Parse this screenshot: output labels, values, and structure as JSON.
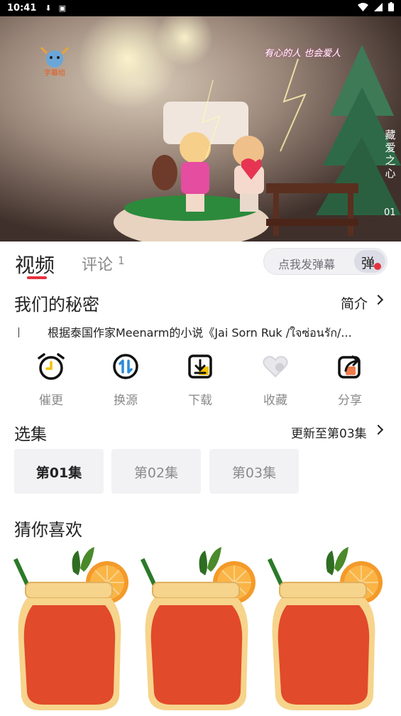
{
  "status_bar": {
    "time": "10:41",
    "icons": [
      "download-icon",
      "notification-icon",
      "wifi-icon",
      "signal-icon",
      "battery-icon"
    ]
  },
  "video": {
    "overlay_subtitle": "有心的人 也会爱人",
    "vertical_title": "藏爱之心",
    "episode_number": "01",
    "logo_caption": "字幕组"
  },
  "tabs": {
    "video_label": "视频",
    "comment_label": "评论",
    "comment_count": "1"
  },
  "danmaku": {
    "placeholder": "点我发弹幕",
    "toggle_label": "弹"
  },
  "drama": {
    "title": "我们的秘密",
    "intro_label": "简介",
    "synopsis": "根据泰国作家Meenarm的小说《Jai Sorn Ruk /ใจซ่อนรัก/..."
  },
  "actions": [
    {
      "label": "催更",
      "icon": "alarm-clock-icon"
    },
    {
      "label": "换源",
      "icon": "switch-source-icon"
    },
    {
      "label": "下载",
      "icon": "download-icon"
    },
    {
      "label": "收藏",
      "icon": "heart-icon"
    },
    {
      "label": "分享",
      "icon": "share-icon"
    }
  ],
  "episodes": {
    "title": "选集",
    "update_label": "更新至第03集",
    "items": [
      "第01集",
      "第02集",
      "第03集"
    ],
    "selected_index": 0
  },
  "recommend": {
    "title": "猜你喜欢"
  },
  "colors": {
    "accent": "#e5323d",
    "muted_text": "#8a8a8a",
    "chip_bg": "#f2f2f4"
  }
}
